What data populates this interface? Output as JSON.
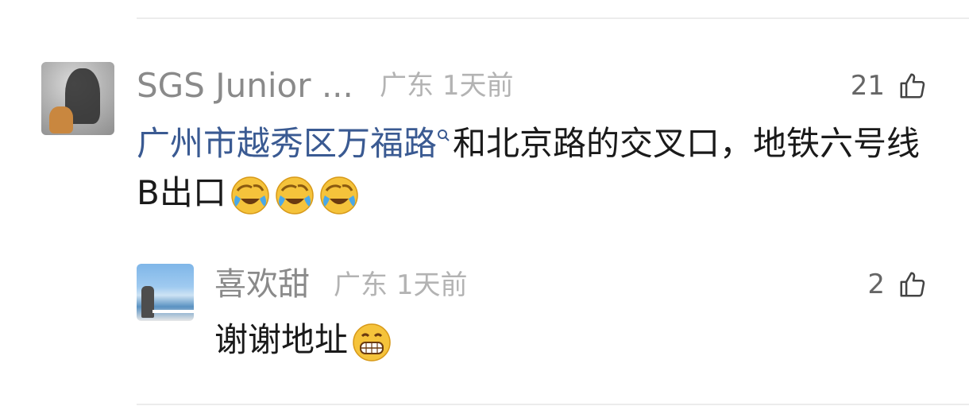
{
  "comments": [
    {
      "username": "SGS Junior ...",
      "location": "广东",
      "time": "1天前",
      "likes": "21",
      "text": {
        "link": "广州市越秀区万福路",
        "rest": "和北京路的交叉口，地铁六号线B出口"
      },
      "emojis": [
        "crying-laughing-emoji",
        "crying-laughing-emoji",
        "crying-laughing-emoji"
      ]
    },
    {
      "username": "喜欢甜",
      "location": "广东",
      "time": "1天前",
      "likes": "2",
      "text": "谢谢地址",
      "emojis": [
        "grinning-emoji"
      ]
    }
  ],
  "icons": {
    "like": "thumbs-up-icon",
    "search": "search-icon"
  },
  "colors": {
    "link": "#3a5a92",
    "username": "#8a8a8a",
    "meta": "#b3b3b3"
  }
}
